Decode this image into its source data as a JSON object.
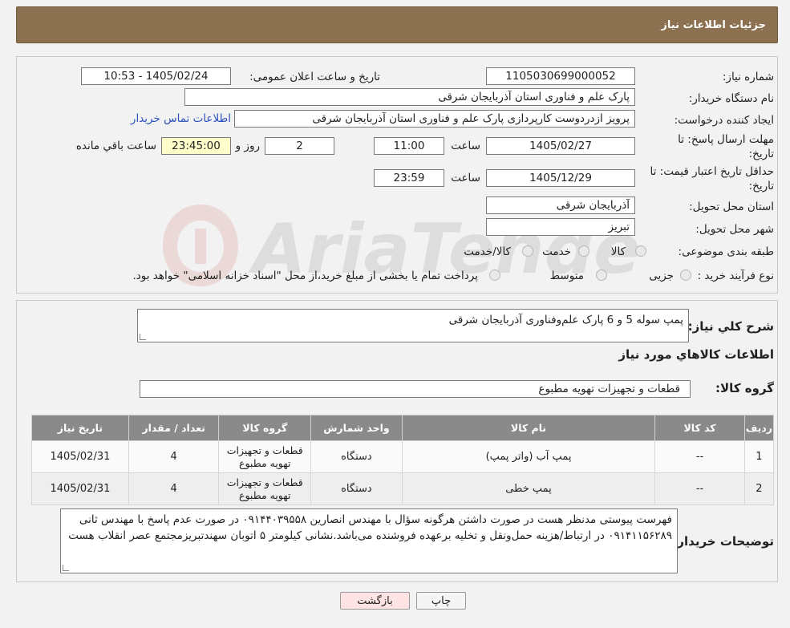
{
  "header": {
    "title": "جزئیات اطلاعات نیاز"
  },
  "form": {
    "need_number_label": "شماره نیاز:",
    "need_number": "1105030699000052",
    "announce_label": "تاریخ و ساعت اعلان عمومی:",
    "announce_value": "1405/02/24 - 10:53",
    "buyer_org_label": "نام دستگاه خریدار:",
    "buyer_org": "پارک علم و فناوری استان آذربایجان شرقی",
    "requester_label": "ایجاد کننده درخواست:",
    "requester": "پرویز ازدردوست کارپردازی پارک علم و فناوری استان آذربایجان شرقی",
    "contact_link": "اطلاعات تماس خریدار",
    "deadline_label_1": "مهلت ارسال پاسخ: تا",
    "deadline_label_2": "تاریخ:",
    "deadline_date": "1405/02/27",
    "time_label": "ساعت",
    "deadline_time": "11:00",
    "days_value": "2",
    "days_label": "روز و",
    "remaining_time": "23:45:00",
    "remaining_label": "ساعت باقي مانده",
    "validity_label_1": "حداقل تاریخ اعتبار قیمت: تا",
    "validity_label_2": "تاریخ:",
    "validity_date": "1405/12/29",
    "validity_time": "23:59",
    "province_label": "استان محل تحویل:",
    "province": "آذربایجان شرقی",
    "city_label": "شهر محل تحویل:",
    "city": "تبریز",
    "category_label": "طبقه بندی موضوعی:",
    "category_options": [
      "کالا",
      "خدمت",
      "کالا/خدمت"
    ],
    "process_label": "نوع فرآیند خرید :",
    "process_options": [
      "جزیی",
      "متوسط"
    ],
    "process_note": "پرداخت تمام یا بخشی از مبلغ خرید،از محل \"اسناد خزانه اسلامی\" خواهد بود."
  },
  "summary": {
    "label": "شرح کلي نیاز:",
    "text": "پمپ سوله 5 و 6 پارک علم‌وفناوری آذربایجان شرقی",
    "goods_title": "اطلاعات کالاهاي مورد نیاز",
    "group_label": "گروه کالا:",
    "group_value": "قطعات و تجهیزات تهویه مطبوع"
  },
  "table": {
    "headers": [
      "ردیف",
      "کد کالا",
      "نام کالا",
      "واحد شمارش",
      "گروه کالا",
      "تعداد / مقدار",
      "تاریخ نیاز"
    ],
    "rows": [
      [
        "1",
        "--",
        "پمپ آب (واتر پمپ)",
        "دستگاه",
        "قطعات و تجهیزات تهویه مطبوع",
        "4",
        "1405/02/31"
      ],
      [
        "2",
        "--",
        "پمپ خطی",
        "دستگاه",
        "قطعات و تجهیزات تهویه مطبوع",
        "4",
        "1405/02/31"
      ]
    ]
  },
  "notes": {
    "label": "توضیحات خریدار:",
    "text": "فهرست پیوستی مدنظر هست در صورت داشتن هرگونه سؤال با مهندس انصارین ۰۹۱۴۴۰۳۹۵۵۸ در صورت عدم پاسخ با مهندس ثانی ۰۹۱۴۱۱۵۶۲۸۹ در ارتباط/هزینه حمل‌ونقل و تخلیه برعهده فروشنده می‌باشد.نشانی کیلومتر ۵ اتوبان سهندتبریزمجتمع عصر انقلاب هست"
  },
  "buttons": {
    "print": "چاپ",
    "back": "بازگشت"
  },
  "watermark": {
    "text": "AriaTender.neT"
  }
}
